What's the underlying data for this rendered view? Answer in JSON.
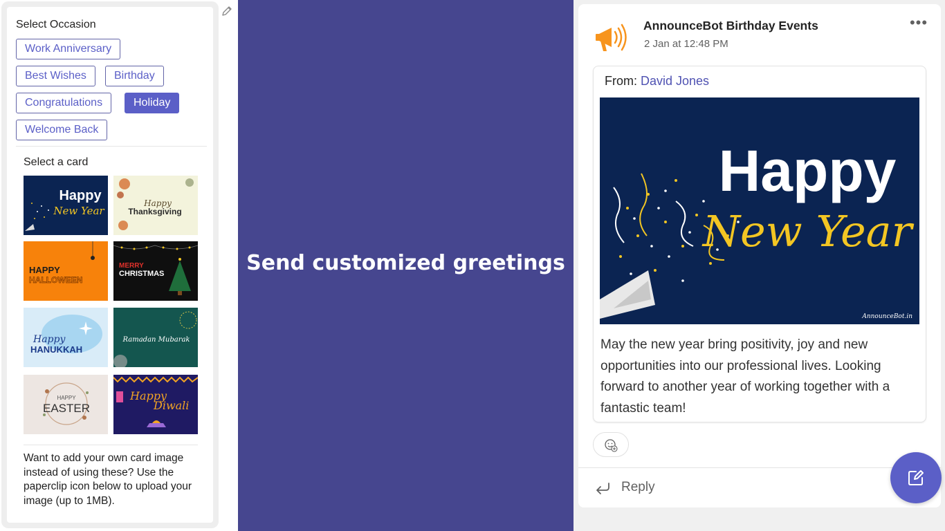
{
  "occasion": {
    "title": "Select Occasion",
    "chips": [
      "Work Anniversary",
      "Best Wishes",
      "Birthday",
      "Congratulations",
      "Holiday",
      "Welcome Back"
    ],
    "selected": "Holiday"
  },
  "cards": {
    "title": "Select a card",
    "thumbnails": [
      {
        "line1": "Happy",
        "line2": "New Year"
      },
      {
        "line1": "Happy",
        "line2": "Thanksgiving"
      },
      {
        "line1": "HAPPY",
        "line2": "HALLOWEEN"
      },
      {
        "line1": "MERRY",
        "line2": "CHRISTMAS"
      },
      {
        "line1": "Happy",
        "line2": "HANUKKAH"
      },
      {
        "line1": "Ramadan Mubarak",
        "line2": ""
      },
      {
        "line1": "HAPPY",
        "line2": "EASTER"
      },
      {
        "line1": "Happy",
        "line2": "Diwali"
      }
    ],
    "help_text": "Want to add your own card image instead of using these? Use the paperclip icon below to upload your image (up to 1MB)."
  },
  "banner": {
    "headline": "Send customized greetings",
    "color": "#46468f"
  },
  "post": {
    "bot_name": "AnnounceBot Birthday Events",
    "time": "2 Jan at 12:48 PM",
    "more": "•••",
    "from_label": "From: ",
    "from_name": "David Jones",
    "card_image": {
      "line1": "Happy",
      "line2": "New Year",
      "watermark": "AnnounceBot.in"
    },
    "message": "May the new year bring positivity, joy and new opportunities into our professional lives. Looking forward to another year of working together with a fantastic team!",
    "reply_label": "Reply"
  },
  "icons": {
    "edit": "pencil-icon",
    "bot": "megaphone-icon",
    "more": "more-options-icon",
    "react": "emoji-reaction-icon",
    "reply": "reply-arrow-icon",
    "compose": "compose-icon"
  },
  "colors": {
    "accent": "#5b5fc7",
    "card_navy": "#0b2452",
    "gold": "#f3c623"
  }
}
